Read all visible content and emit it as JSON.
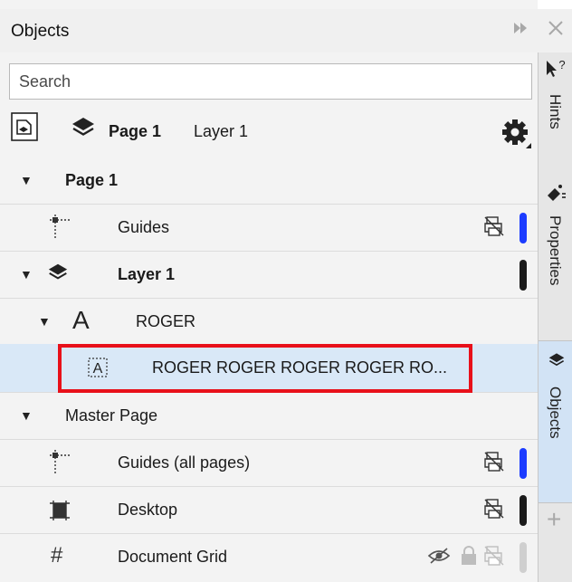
{
  "panel": {
    "title": "Objects",
    "expand_icon": "double-chevron-right-icon",
    "close_icon": "close-icon"
  },
  "search": {
    "placeholder": "Search"
  },
  "toolbar": {
    "current_page": "Page 1",
    "current_layer": "Layer 1"
  },
  "tree": {
    "page1": {
      "label": "Page 1"
    },
    "guides": {
      "label": "Guides",
      "color": "#1c3cff"
    },
    "layer1": {
      "label": "Layer 1",
      "color": "#1a1a1a"
    },
    "text_group": {
      "icon_char": "A",
      "label": "ROGER"
    },
    "text_object": {
      "label": "ROGER ROGER ROGER ROGER RO..."
    },
    "master_page": {
      "label": "Master Page"
    },
    "guides_all": {
      "label": "Guides (all pages)",
      "color": "#1c3cff"
    },
    "desktop": {
      "label": "Desktop",
      "color": "#1a1a1a"
    },
    "document_grid": {
      "label": "Document Grid",
      "color": "#cfcfcf"
    }
  },
  "highlight": {
    "color": "#e8101a"
  },
  "sidebar": {
    "hints_label": "Hints",
    "properties_label": "Properties",
    "objects_label": "Objects",
    "add_label": "+"
  }
}
